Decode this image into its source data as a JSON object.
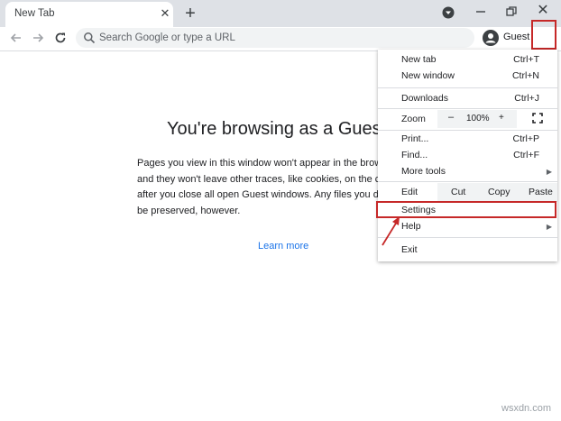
{
  "tab": {
    "title": "New Tab"
  },
  "omnibox": {
    "placeholder": "Search Google or type a URL"
  },
  "profile": {
    "label": "Guest"
  },
  "page": {
    "headline": "You're browsing as a Guest",
    "body_lines": [
      "Pages you view in this window won't appear in the browser",
      "and they won't leave other traces, like cookies, on the con",
      "after you close all open Guest windows. Any files you dow",
      "be preserved, however."
    ],
    "learn_more": "Learn more"
  },
  "menu": {
    "new_tab": {
      "label": "New tab",
      "shortcut": "Ctrl+T"
    },
    "new_window": {
      "label": "New window",
      "shortcut": "Ctrl+N"
    },
    "downloads": {
      "label": "Downloads",
      "shortcut": "Ctrl+J"
    },
    "zoom": {
      "label": "Zoom",
      "minus": "–",
      "value": "100%",
      "plus": "+"
    },
    "print": {
      "label": "Print...",
      "shortcut": "Ctrl+P"
    },
    "find": {
      "label": "Find...",
      "shortcut": "Ctrl+F"
    },
    "more_tools": {
      "label": "More tools"
    },
    "edit": {
      "label": "Edit",
      "cut": "Cut",
      "copy": "Copy",
      "paste": "Paste"
    },
    "settings": {
      "label": "Settings"
    },
    "help": {
      "label": "Help"
    },
    "exit": {
      "label": "Exit"
    }
  },
  "watermark": "wsxdn.com",
  "colors": {
    "highlight": "#c62828",
    "link": "#1a73e8",
    "tabstrip": "#dee1e6"
  }
}
